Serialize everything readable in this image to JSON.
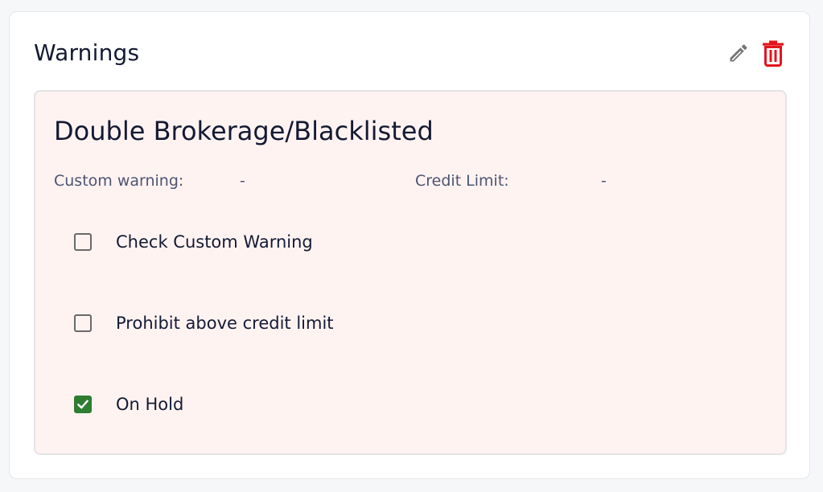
{
  "card": {
    "title": "Warnings",
    "edit_icon": "pencil-icon",
    "delete_icon": "trash-icon",
    "colors": {
      "delete": "#e5141b",
      "edit": "#757575",
      "checked": "#2e7d32",
      "warning_background": "#fff3f2"
    }
  },
  "warning": {
    "name": "Double Brokerage/Blacklisted",
    "custom_warning_label": "Custom warning:",
    "custom_warning_value": "-",
    "credit_limit_label": "Credit Limit:",
    "credit_limit_value": "-",
    "options": [
      {
        "label": "Check Custom Warning",
        "checked": false
      },
      {
        "label": "Prohibit above credit limit",
        "checked": false
      },
      {
        "label": "On Hold",
        "checked": true
      }
    ]
  }
}
